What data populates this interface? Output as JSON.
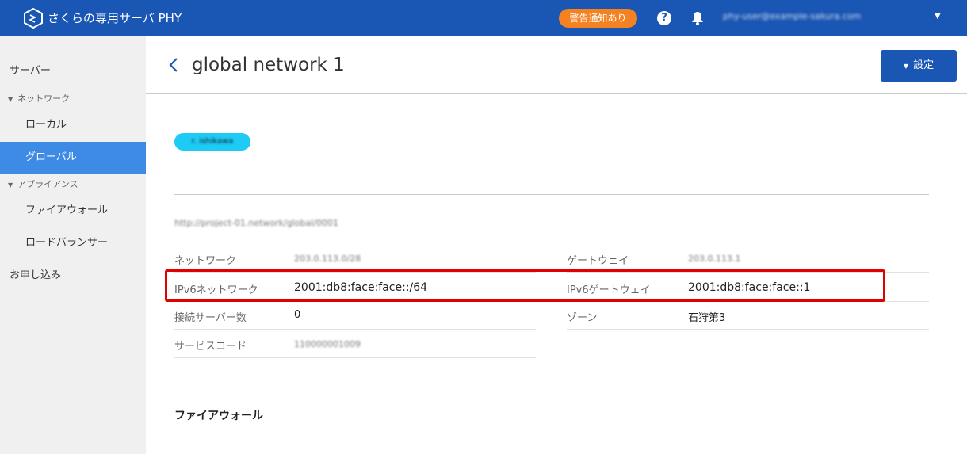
{
  "header": {
    "brand": "さくらの専用サーバ PHY",
    "alert_badge": "警告通知あり",
    "help_label": "?",
    "user_email": "phy-user@example-sakura.com",
    "caret": "▼"
  },
  "sidebar": {
    "servers": "サーバー",
    "network_group": "ネットワーク",
    "local": "ローカル",
    "global": "グローバル",
    "appliance_group": "アプライアンス",
    "firewall": "ファイアウォール",
    "load_balancer": "ロードバランサー",
    "application": "お申し込み",
    "group_caret": "▼"
  },
  "page": {
    "back_label": "back",
    "title": "global network 1",
    "settings_button": "設定",
    "settings_caret": "▼",
    "tag": "r. ishikawa",
    "description": "http://project-01.network/global/0001",
    "section_firewall": "ファイアウォール"
  },
  "details": {
    "network_label": "ネットワーク",
    "network_value": "203.0.113.0/28",
    "gateway_label": "ゲートウェイ",
    "gateway_value": "203.0.113.1",
    "ipv6_network_label": "IPv6ネットワーク",
    "ipv6_network_value": "2001:db8:face:face::/64",
    "ipv6_gateway_label": "IPv6ゲートウェイ",
    "ipv6_gateway_value": "2001:db8:face:face::1",
    "connected_servers_label": "接続サーバー数",
    "connected_servers_value": "0",
    "zone_label": "ゾーン",
    "zone_value": "石狩第3",
    "service_code_label": "サービスコード",
    "service_code_value": "110000001009"
  },
  "colors": {
    "topbar": "#1a56b4",
    "alert": "#f58220",
    "active_nav": "#3d8be4",
    "tag": "#1ecbf4",
    "highlight": "#e00000"
  }
}
